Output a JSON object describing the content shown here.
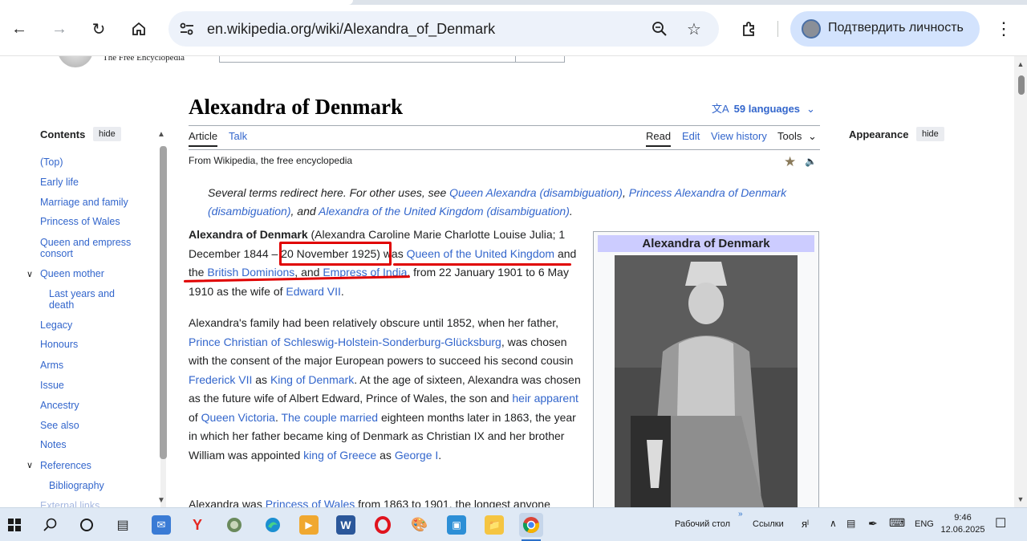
{
  "browser": {
    "url_host": "en.wikipedia.org",
    "url_path": "/wiki/Alexandra_of_Denmark",
    "profile_label": "Подтвердить личность"
  },
  "wiki": {
    "tagline": "The Free Encyclopedia",
    "title": "Alexandra of Denmark",
    "languages": "59 languages",
    "tabs": {
      "article": "Article",
      "talk": "Talk",
      "read": "Read",
      "edit": "Edit",
      "history": "View history",
      "tools": "Tools"
    },
    "from": "From Wikipedia, the free encyclopedia",
    "hatnote": {
      "lead": "Several terms redirect here. For other uses, see ",
      "link1": "Queen Alexandra (disambiguation)",
      "sep1": ", ",
      "link2": "Princess Alexandra of Denmark (disambiguation)",
      "sep2": ", and ",
      "link3": "Alexandra of the United Kingdom (disambiguation)",
      "end": "."
    },
    "p1": {
      "bold": "Alexandra of Denmark",
      "t1": " (Alexandra Caroline Marie Charlotte Louise Julia; 1 December 1844 – ",
      "date": "20 November 1925",
      "t2": ") was ",
      "l1": "Queen of the United Kingdom",
      "t3": " and the ",
      "l2": "British Dominions",
      "t4": ", and ",
      "l3": "Empress of India",
      "t5": ", from 22 January 1901 to 6 May 1910 as the wife of ",
      "l4": "Edward VII",
      "t6": "."
    },
    "p2": {
      "t1": "Alexandra's family had been relatively obscure until 1852, when her father, ",
      "l1": "Prince Christian of Schleswig-Holstein-Sonderburg-Glücksburg",
      "t2": ", was chosen with the consent of the major European powers to succeed his second cousin ",
      "l2": "Frederick VII",
      "t3": " as ",
      "l3": "King of Denmark",
      "t4": ". At the age of sixteen, Alexandra was chosen as the future wife of Albert Edward, Prince of Wales, the son and ",
      "l4": "heir apparent",
      "t5": " of ",
      "l5": "Queen Victoria",
      "t6": ". ",
      "l6": "The couple married",
      "t7": " eighteen months later in 1863, the year in which her father became king of Denmark as Christian IX and her brother William was appointed ",
      "l7": "king of Greece",
      "t8": " as ",
      "l8": "George I",
      "t9": "."
    },
    "p3": {
      "t1": "Alexandra was ",
      "l1": "Princess of Wales",
      "t2": " from 1863 to 1901, the longest anyone"
    },
    "infobox_title": "Alexandra of Denmark"
  },
  "toc": {
    "heading": "Contents",
    "hide": "hide",
    "items": [
      "(Top)",
      "Early life",
      "Marriage and family",
      "Princess of Wales",
      "Queen and empress consort",
      "Queen mother",
      "Last years and death",
      "Legacy",
      "Honours",
      "Arms",
      "Issue",
      "Ancestry",
      "See also",
      "Notes",
      "References",
      "Bibliography",
      "External links"
    ]
  },
  "appearance": {
    "heading": "Appearance",
    "hide": "hide"
  },
  "taskbar": {
    "desktop": "Рабочий стол",
    "links": "Ссылки",
    "lang": "ENG",
    "time": "9:46",
    "date": "12.06.2025"
  },
  "colors": {
    "link": "#3366cc",
    "annotation": "#e00000",
    "infobox_header": "#ccccff"
  }
}
